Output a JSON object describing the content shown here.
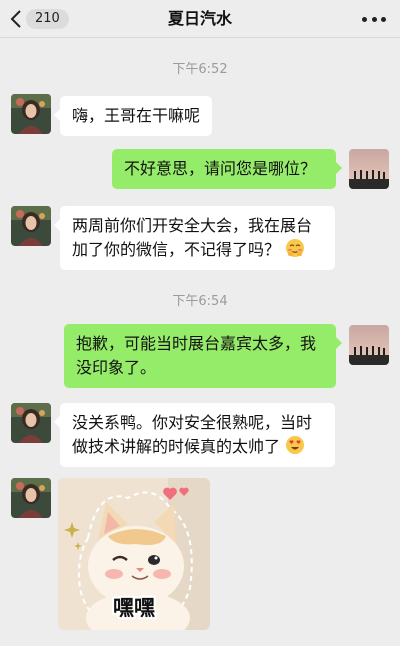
{
  "nav": {
    "unread_badge": "210",
    "chat_title": "夏日汽水"
  },
  "chat": {
    "timestamps": [
      "下午6:52",
      "下午6:54"
    ],
    "messages": [
      {
        "from": "other",
        "text": "嗨，王哥在干嘛呢"
      },
      {
        "from": "me",
        "text": "不好意思，请问您是哪位？"
      },
      {
        "from": "other",
        "text": "两周前你们开安全大会，我在展台加了你的微信，不记得了吗？",
        "emoji": "blush-emoji"
      },
      {
        "from": "me",
        "text": "抱歉，可能当时展台嘉宾太多，我没印象了。"
      },
      {
        "from": "other",
        "text": "没关系鸭。你对安全很熟呢，当时做技术讲解的时候真的太帅了",
        "emoji": "heart-eyes-emoji"
      },
      {
        "from": "other",
        "type": "sticker",
        "sticker_text": "嘿嘿",
        "sticker": "smiling-cat-sticker"
      }
    ]
  },
  "colors": {
    "background": "#ededed",
    "incoming_bubble": "#ffffff",
    "outgoing_bubble": "#95ec69",
    "timestamp": "#9b9b9b"
  }
}
